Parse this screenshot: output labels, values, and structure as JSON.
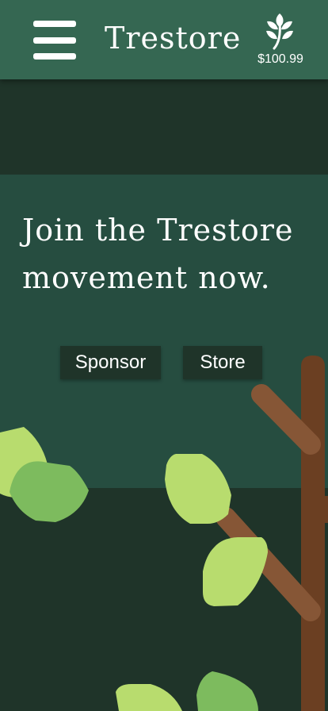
{
  "header": {
    "title": "Trestore",
    "menu_icon": "hamburger-menu-icon",
    "balance_icon": "sprout-icon",
    "balance": "$100.99"
  },
  "hero": {
    "heading_line1": "Join the Trestore",
    "heading_line2": "movement now.",
    "buttons": {
      "sponsor_label": "Sponsor",
      "store_label": "Store"
    }
  },
  "illustration": {
    "icons": [
      "tree-branch-icon",
      "leaf-icon"
    ]
  },
  "colors": {
    "header_bg": "#356752",
    "page_bg": "#1f3429",
    "hero_bg": "#264d40",
    "button_bg": "#1f3429",
    "text": "#ffffff",
    "trunk": "#6b3f22",
    "branch": "#865636",
    "leaf_light": "#b8dc6e",
    "leaf_mid": "#7dbb5e"
  }
}
